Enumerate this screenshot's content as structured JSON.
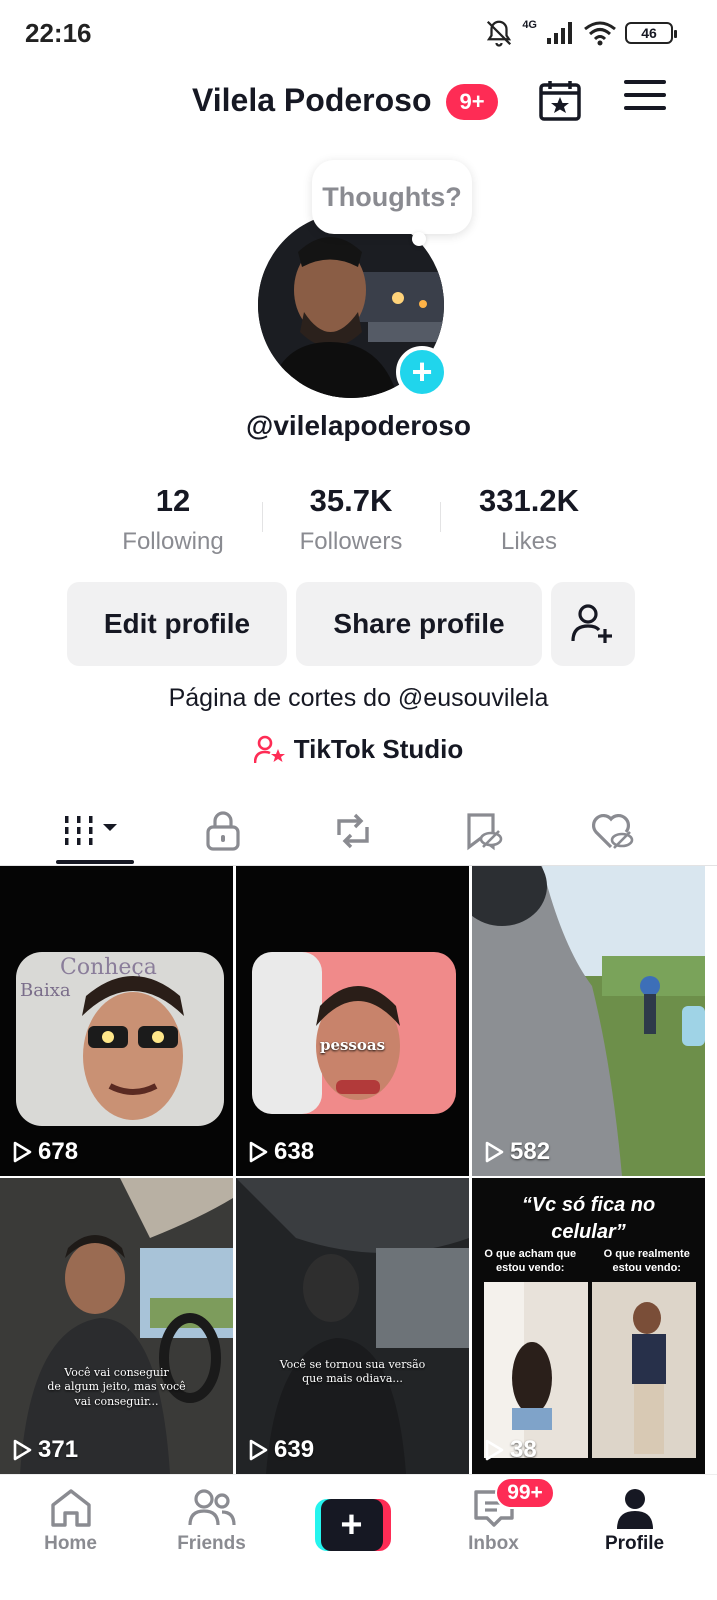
{
  "status_bar": {
    "time": "22:16",
    "network": "4G",
    "battery": "46",
    "icons": [
      "bell-muted-icon",
      "signal-icon",
      "wifi-icon",
      "battery-icon"
    ]
  },
  "header": {
    "title": "Vilela Poderoso",
    "badge": "9+",
    "calendar_icon": "calendar-star-icon",
    "menu_icon": "hamburger-menu-icon"
  },
  "profile": {
    "thought_prompt": "Thoughts?",
    "username": "@vilelapoderoso",
    "bio": "Página de cortes do @eusouvilela",
    "studio_label": "TikTok Studio"
  },
  "stats": [
    {
      "value": "12",
      "label": "Following"
    },
    {
      "value": "35.7K",
      "label": "Followers"
    },
    {
      "value": "331.2K",
      "label": "Likes"
    }
  ],
  "actions": {
    "edit_profile": "Edit profile",
    "share_profile": "Share profile"
  },
  "tabs": [
    {
      "icon": "videos-grid-icon",
      "active": true
    },
    {
      "icon": "lock-icon",
      "active": false
    },
    {
      "icon": "repost-icon",
      "active": false
    },
    {
      "icon": "bookmark-hidden-icon",
      "active": false
    },
    {
      "icon": "liked-hidden-icon",
      "active": false
    }
  ],
  "videos": [
    {
      "views": "678"
    },
    {
      "views": "638",
      "overlay": "pessoas"
    },
    {
      "views": "582"
    },
    {
      "views": "371",
      "overlay": "Você vai conseguir\nde algum jeito, mas você\nvai conseguir..."
    },
    {
      "views": "639",
      "overlay": "Você se tornou sua versão\nque mais odiava..."
    },
    {
      "views": "38",
      "caption": "“Vc só fica no\ncelular”",
      "left_label": "O que acham que\nestou vendo:",
      "right_label": "O que realmente\nestou vendo:"
    }
  ],
  "bottom_nav": {
    "home": "Home",
    "friends": "Friends",
    "inbox": "Inbox",
    "inbox_badge": "99+",
    "profile": "Profile"
  },
  "colors": {
    "accent_red": "#fe2c55",
    "accent_cyan": "#25f4ee",
    "avatar_add": "#20d5ec",
    "text_primary": "#161823",
    "text_secondary": "#8a8b91"
  }
}
